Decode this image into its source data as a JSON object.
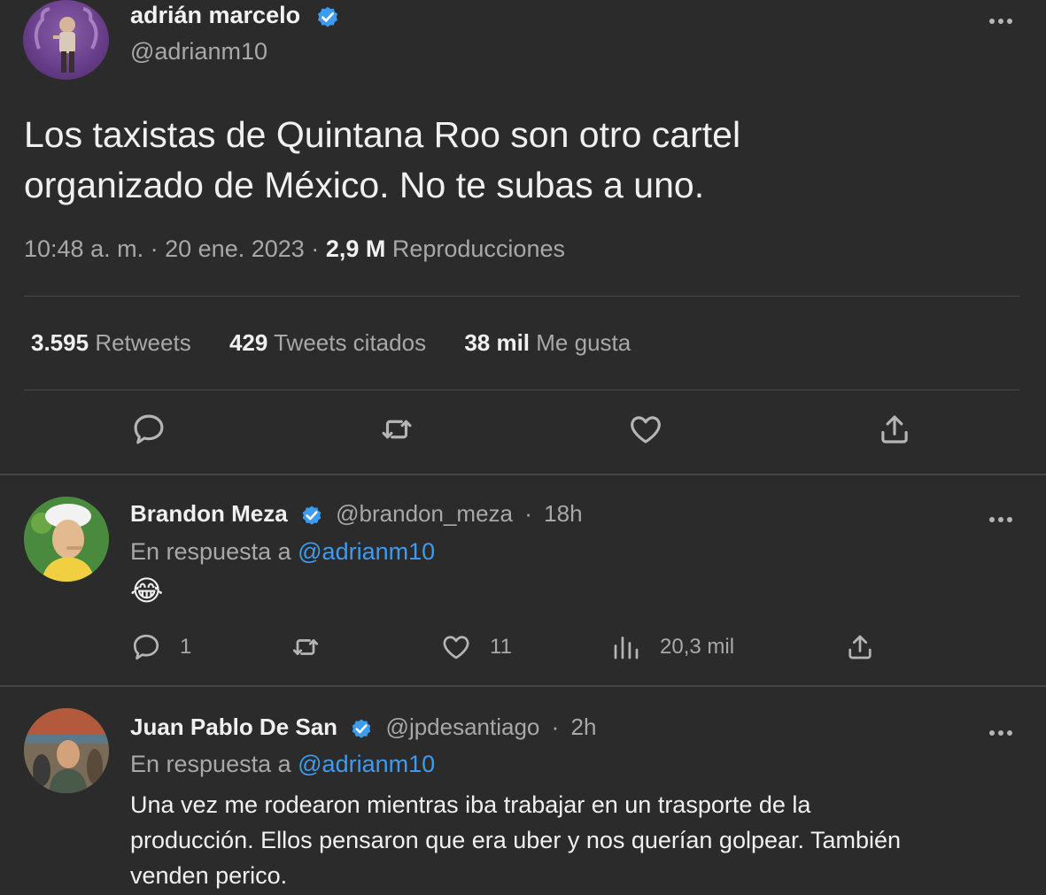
{
  "main_tweet": {
    "author_name": "adrián marcelo",
    "author_handle": "@adrianm10",
    "text_line1": "Los taxistas de Quintana Roo son otro cartel",
    "text_line2": "organizado de México. No te subas a uno.",
    "time": "10:48 a. m.",
    "separator": "·",
    "date": "20 ene. 2023",
    "views_count": "2,9 M",
    "views_label": "Reproducciones",
    "stats": {
      "retweets_count": "3.595",
      "retweets_label": "Retweets",
      "quotes_count": "429",
      "quotes_label": "Tweets citados",
      "likes_count": "38 mil",
      "likes_label": "Me gusta"
    },
    "icons": [
      "reply-icon",
      "retweet-icon",
      "like-icon",
      "share-icon"
    ]
  },
  "replies": [
    {
      "author_name": "Brandon Meza",
      "author_handle": "@brandon_meza",
      "time": "18h",
      "context_prefix": "En respuesta a",
      "context_mention": "@adrianm10",
      "text": "😂",
      "reply_count": "1",
      "like_count": "11",
      "views_count": "20,3 mil"
    },
    {
      "author_name": "Juan Pablo De San",
      "author_handle": "@jpdesantiago",
      "time": "2h",
      "context_prefix": "En respuesta a",
      "context_mention": "@adrianm10",
      "text_line1": "Una vez me rodearon mientras iba trabajar en un trasporte de la",
      "text_line2": "producción. Ellos pensaron que era uber y nos querían golpear. También",
      "text_line3": "venden perico."
    }
  ],
  "colors": {
    "background": "#2b2b2b",
    "text_primary": "#f0f0f0",
    "text_secondary": "#a8a8a8",
    "accent": "#3d9bf0"
  }
}
